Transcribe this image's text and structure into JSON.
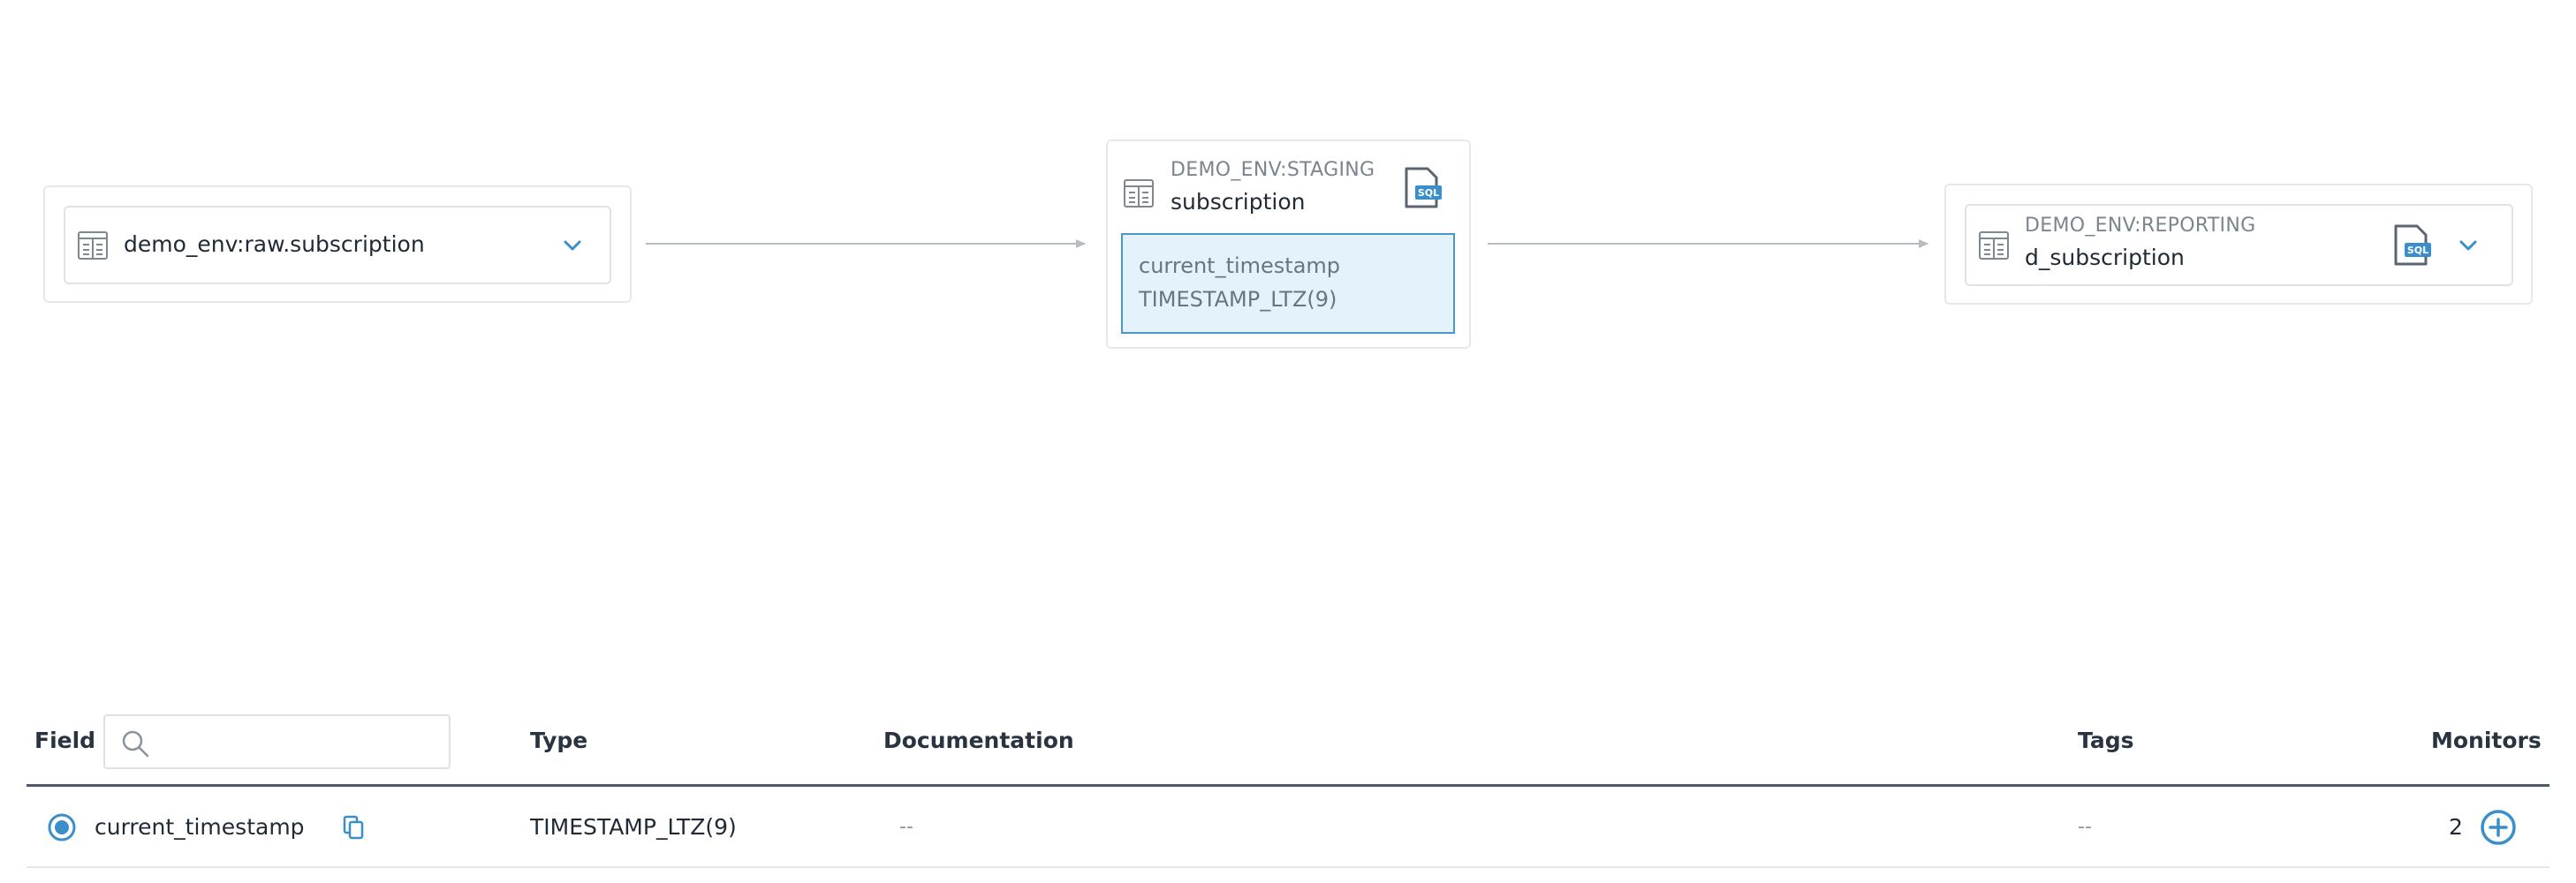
{
  "lineage": {
    "upstream": {
      "name": "demo_env:raw.subscription",
      "icon": "table-icon",
      "expand_icon": "chevron-down-icon"
    },
    "current": {
      "database": "DEMO_ENV:STAGING",
      "name": "subscription",
      "icon": "table-icon",
      "sql_icon": "sql-file-icon",
      "field": {
        "name": "current_timestamp",
        "type": "TIMESTAMP_LTZ(9)"
      }
    },
    "downstream": {
      "database": "DEMO_ENV:REPORTING",
      "name": "d_subscription",
      "icon": "table-icon",
      "sql_icon": "sql-file-icon",
      "expand_icon": "chevron-down-icon"
    }
  },
  "fields_table": {
    "headers": {
      "field": "Field",
      "type": "Type",
      "documentation": "Documentation",
      "tags": "Tags",
      "monitors": "Monitors"
    },
    "search": {
      "placeholder": "",
      "value": ""
    },
    "rows": [
      {
        "field": "current_timestamp",
        "type": "TIMESTAMP_LTZ(9)",
        "documentation": "--",
        "tags": "--",
        "monitors": "2",
        "selected": true
      }
    ]
  },
  "colors": {
    "accent": "#3a8fcb",
    "highlight_bg": "#e3f2fb",
    "edge": "#b5bcc3",
    "header_rule": "#4d5a66"
  }
}
